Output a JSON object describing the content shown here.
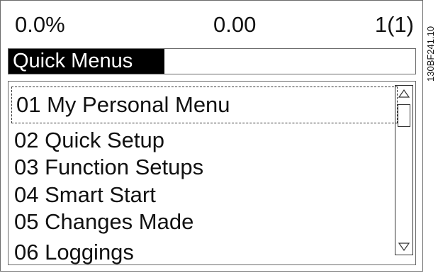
{
  "status": {
    "left_value": "0.0%",
    "center_value": "0.00",
    "right_value": "1(1)"
  },
  "side_code": "130BF241.10",
  "title": "Quick Menus",
  "menu": {
    "items": [
      {
        "label": "01  My Personal Menu",
        "selected": true
      },
      {
        "label": "02 Quick Setup",
        "selected": false
      },
      {
        "label": "03 Function Setups",
        "selected": false
      },
      {
        "label": "04 Smart Start",
        "selected": false
      },
      {
        "label": "05  Changes Made",
        "selected": false
      },
      {
        "label": "06 Loggings",
        "selected": false
      }
    ]
  },
  "icons": {
    "scroll_up": "triangle-up-icon",
    "scroll_down": "triangle-down-icon"
  }
}
